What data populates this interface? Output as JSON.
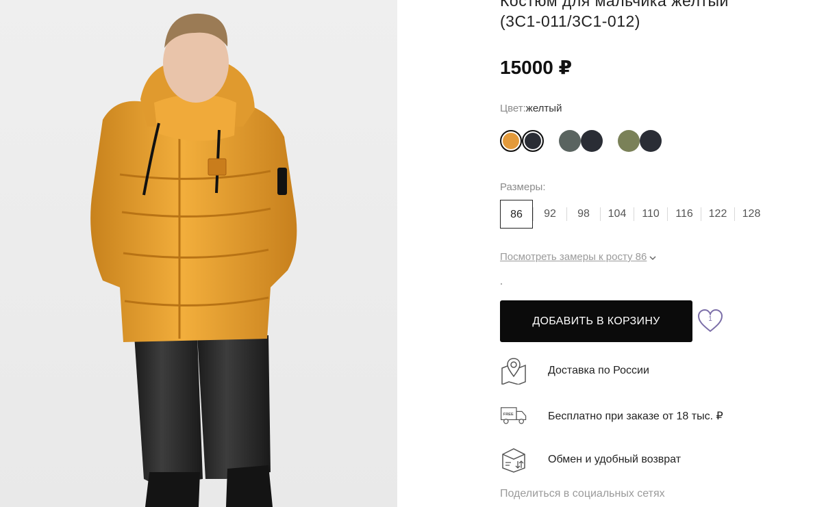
{
  "product": {
    "title_line1": "Костюм для мальчика желтый",
    "title_line2": "(3С1-011/3С1-012)",
    "price": "15000 ₽",
    "photo_alt": "Мальчик в желтой куртке и черных брюках"
  },
  "color": {
    "label": "Цвет:",
    "value": "желтый",
    "swatch_groups": [
      {
        "colors": [
          "#e39a3b",
          "#2a2d35"
        ],
        "selected": true
      },
      {
        "colors": [
          "#5a6460",
          "#2a2d35"
        ],
        "selected": false
      },
      {
        "colors": [
          "#7a8158",
          "#2a2d35"
        ],
        "selected": false
      }
    ]
  },
  "sizes": {
    "label": "Размеры:",
    "items": [
      "86",
      "92",
      "98",
      "104",
      "110",
      "116",
      "122",
      "128"
    ],
    "selected": "86"
  },
  "measure_link": "Посмотреть замеры к росту 86",
  "cart": {
    "button_label": "ДОБАВИТЬ В КОРЗИНУ",
    "wishlist_count": "1"
  },
  "features": [
    {
      "icon": "map-pin-icon",
      "text": "Доставка по России"
    },
    {
      "icon": "free-delivery-truck-icon",
      "text": "Бесплатно при заказе от 18 тыс. ₽"
    },
    {
      "icon": "return-box-icon",
      "text": "Обмен и удобный возврат"
    }
  ],
  "share_label": "Поделиться в социальных сетях",
  "colors": {
    "accent": "#0b0b0b",
    "muted_text": "#8a8a8a",
    "heart": "#7b6ea8"
  }
}
